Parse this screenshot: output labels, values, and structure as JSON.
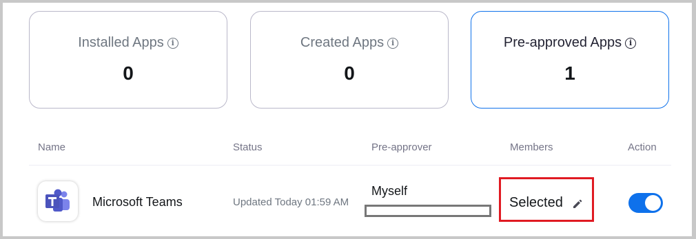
{
  "cards": [
    {
      "title": "Installed Apps",
      "count": "0",
      "info_icon": "info-icon"
    },
    {
      "title": "Created Apps",
      "count": "0",
      "info_icon": "info-icon"
    },
    {
      "title": "Pre-approved Apps",
      "count": "1",
      "info_icon": "info-icon"
    }
  ],
  "table": {
    "headers": {
      "name": "Name",
      "status": "Status",
      "preapprover": "Pre-approver",
      "members": "Members",
      "action": "Action"
    },
    "rows": [
      {
        "icon": "microsoft-teams-icon",
        "name": "Microsoft Teams",
        "status": "Updated Today 01:59 AM",
        "preapprover": "Myself",
        "members": "Selected",
        "members_icon": "pencil-icon",
        "toggle_on": true
      }
    ]
  },
  "colors": {
    "accent": "#0e71eb",
    "highlight_box": "#e01a22",
    "teams_purple": "#5059c9"
  }
}
